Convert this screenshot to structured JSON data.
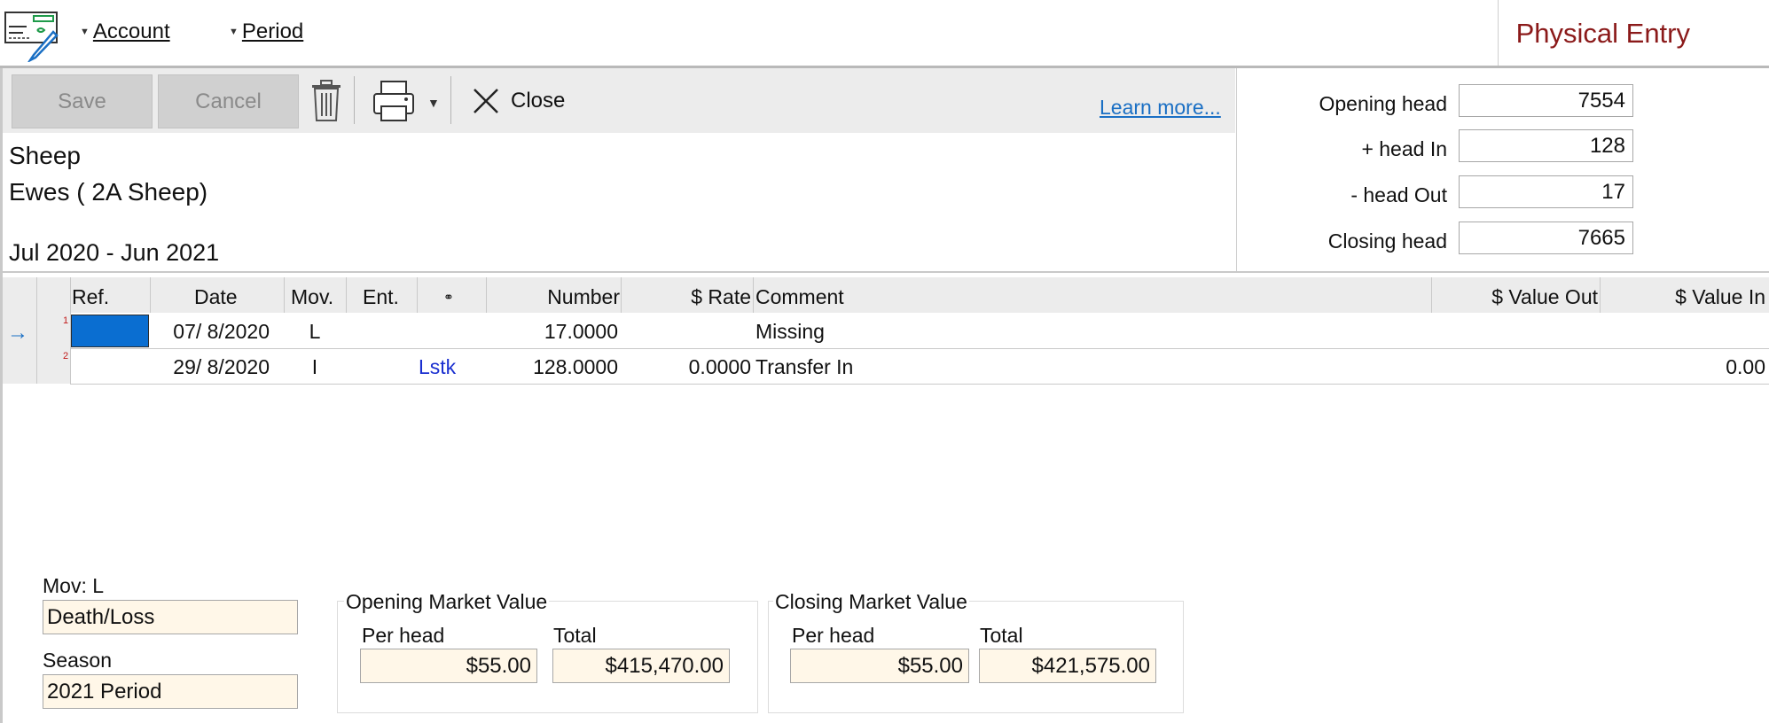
{
  "menu": {
    "account": "Account",
    "period": "Period"
  },
  "app_title": "Physical Entry",
  "toolbar": {
    "save": "Save",
    "cancel": "Cancel",
    "close": "Close",
    "learn_more": "Learn more..."
  },
  "header": {
    "enterprise": "Sheep",
    "class": "Ewes ( 2A Sheep)",
    "period": "Jul 2020 - Jun 2021"
  },
  "stats": {
    "opening_label": "Opening head",
    "opening_value": "7554",
    "in_label": "+ head In",
    "in_value": "128",
    "out_label": "- head Out",
    "out_value": "17",
    "closing_label": "Closing head",
    "closing_value": "7665"
  },
  "grid": {
    "columns": {
      "ref": "Ref.",
      "date": "Date",
      "mov": "Mov.",
      "ent": "Ent.",
      "link": "link-icon",
      "number": "Number",
      "rate": "$ Rate",
      "comment": "Comment",
      "value_out": "$ Value Out",
      "value_in": "$ Value In"
    },
    "rows": [
      {
        "num": "1",
        "ref": "",
        "date": "07/ 8/2020",
        "mov": "L",
        "ent": "",
        "link": "",
        "number": "17.0000",
        "rate": "",
        "comment": "Missing",
        "value_out": "",
        "value_in": ""
      },
      {
        "num": "2",
        "ref": "",
        "date": "29/ 8/2020",
        "mov": "I",
        "ent": "",
        "link": "Lstk",
        "number": "128.0000",
        "rate": "0.0000",
        "comment": "Transfer In",
        "value_out": "",
        "value_in": "0.00"
      }
    ]
  },
  "details": {
    "mov_label": "Mov: L",
    "mov_value": "Death/Loss",
    "season_label": "Season",
    "season_value": "2021 Period",
    "opening_mv": {
      "title": "Opening Market Value",
      "per_head_label": "Per head",
      "per_head": "$55.00",
      "total_label": "Total",
      "total": "$415,470.00"
    },
    "closing_mv": {
      "title": "Closing Market Value",
      "per_head_label": "Per head",
      "per_head": "$55.00",
      "total_label": "Total",
      "total": "$421,575.00"
    }
  },
  "colors": {
    "accent_title": "#8b1a1a",
    "link": "#1a6fc4",
    "selected_cell": "#0a6ed1",
    "field_bg": "#fff7e8"
  }
}
